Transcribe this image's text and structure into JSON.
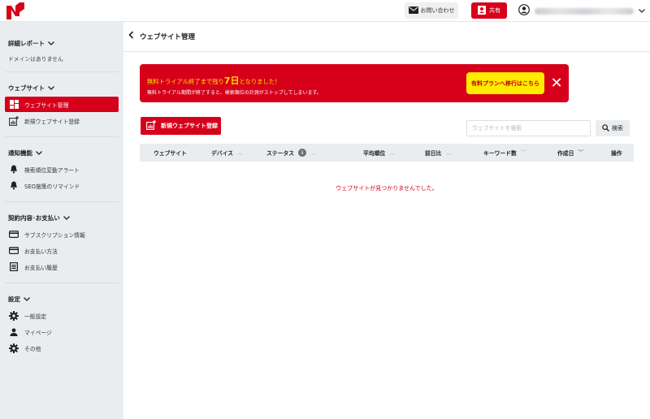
{
  "topbar": {
    "contact_label": "お問い合わせ",
    "share_label": "共有",
    "account_email_blurred": ""
  },
  "sidebar": {
    "reports": {
      "title": "詳細レポート",
      "note": "ドメインはありません"
    },
    "website": {
      "title": "ウェブサイト",
      "items": [
        {
          "label": "ウェブサイト管理",
          "icon": "dashboard-icon",
          "active": true
        },
        {
          "label": "新規ウェブサイト登録",
          "icon": "add-chart-icon",
          "active": false
        }
      ]
    },
    "notifications": {
      "title": "通知機能",
      "items": [
        {
          "label": "検索順位変動アラート",
          "icon": "bell-icon"
        },
        {
          "label": "SEO施策のリマインド",
          "icon": "bell-icon"
        }
      ]
    },
    "billing": {
      "title": "契約内容･お支払い",
      "items": [
        {
          "label": "サブスクリプション情報",
          "icon": "card-icon"
        },
        {
          "label": "お支払い方法",
          "icon": "card-icon"
        },
        {
          "label": "お支払い履歴",
          "icon": "receipt-icon"
        }
      ]
    },
    "settings": {
      "title": "設定",
      "items": [
        {
          "label": "一般設定",
          "icon": "gear-icon"
        },
        {
          "label": "マイページ",
          "icon": "person-icon"
        },
        {
          "label": "その他",
          "icon": "gear-icon"
        }
      ]
    }
  },
  "main": {
    "title": "ウェブサイト管理",
    "banner": {
      "title_prefix": "無料トライアル終了まで残り",
      "days": "7日",
      "title_suffix": "となりました！",
      "subtitle": "無料トライアル期間が終了すると、検索順位の計測がストップしてしまいます。",
      "cta_label": "有料プランへ移行はこちら",
      "close_glyph": "✕"
    },
    "add_button_label": "新規ウェブサイト登録",
    "search": {
      "placeholder": "ウェブサイトを検索",
      "button_label": "検索"
    },
    "table": {
      "columns": [
        "ウェブサイト",
        "デバイス",
        "ステータス",
        "平均順位",
        "前日比",
        "キーワード数",
        "作成日",
        "操作"
      ],
      "empty_message": "ウェブサイトが見つかりませんでした。"
    }
  },
  "colors": {
    "brand_red": "#d7001a",
    "cta_yellow": "#ffeb00",
    "sidebar_bg": "#eaedf0"
  }
}
